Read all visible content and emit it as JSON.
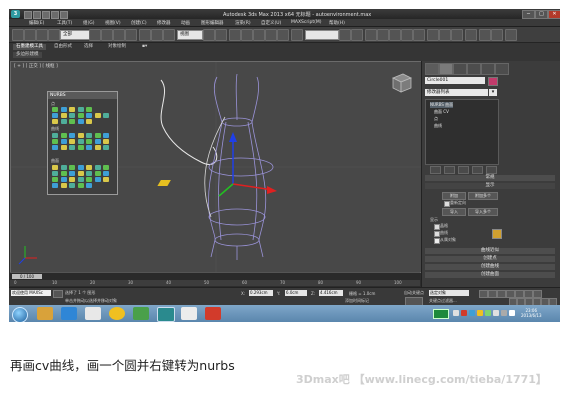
{
  "window": {
    "title": "Autodesk 3ds Max 2013 x64    无标题 - autoenvironment.max",
    "logo_text": "3",
    "minimize": "−",
    "maximize": "□",
    "close": "✕"
  },
  "menu": [
    "编辑(E)",
    "工具(T)",
    "组(G)",
    "视图(V)",
    "创建(C)",
    "修改器",
    "动画",
    "图形编辑器",
    "渲染(R)",
    "自定义(U)",
    "MAXScript(M)",
    "帮助(H)"
  ],
  "toolbar": {
    "selection_filter": "全部",
    "ref_coord": "视图"
  },
  "ribbon_tabs": [
    "石墨建模工具",
    "自由形式",
    "选择",
    "对象绘制"
  ],
  "ribbon_sub": "多边形建模",
  "viewport": {
    "label": "[ + ] [ 正交 ] [ 线框 ]"
  },
  "nurbs_panel": {
    "title": "NURBS",
    "sections": [
      "点",
      "曲线",
      "曲面"
    ]
  },
  "command_panel": {
    "object_name": "Circle001",
    "object_color": "#c23b6b",
    "modifier_list": "修改器列表",
    "stack": [
      "NURBS 曲面",
      "曲面 CV",
      "点",
      "曲线"
    ],
    "rollouts": [
      "常规",
      "显示"
    ],
    "buttons": {
      "attach": "附加",
      "attach_multiple": "附加多个",
      "reorient": "重新定向",
      "import": "导入",
      "import_multiple": "导入多个"
    },
    "display_label": "显示",
    "checkboxes": [
      "晶格",
      "曲线",
      "从属对象"
    ],
    "rollouts2": [
      "曲线近似",
      "创建点",
      "创建曲线",
      "创建曲面"
    ],
    "reorient_label": "重新定向"
  },
  "timeline": {
    "slider": "0 / 100",
    "ruler": [
      "0",
      "10",
      "20",
      "30",
      "40",
      "50",
      "60",
      "70",
      "80",
      "90",
      "100"
    ]
  },
  "status": {
    "selected": "选择了 1 个 图形",
    "prompt": "单击并拖动以选择并移动对象",
    "x": "0.293cm",
    "y": "6.0cm",
    "z": "4.416cm",
    "grid": "栅格 = 1.0cm",
    "auto_key": "自动关键点",
    "set_key_filter": "选定对象",
    "add_time_tag": "添加时间标记",
    "welcome": "欢迎使用 MAXSc",
    "key_filters": "关键点过滤器..."
  },
  "taskbar": {
    "clock_time": "23:06",
    "clock_date": "2013/6/13"
  },
  "caption": "再画cv曲线，画一个圆并右键转为nurbs",
  "watermark": "3Dmax吧 【www.linecg.com/tieba/1771】"
}
